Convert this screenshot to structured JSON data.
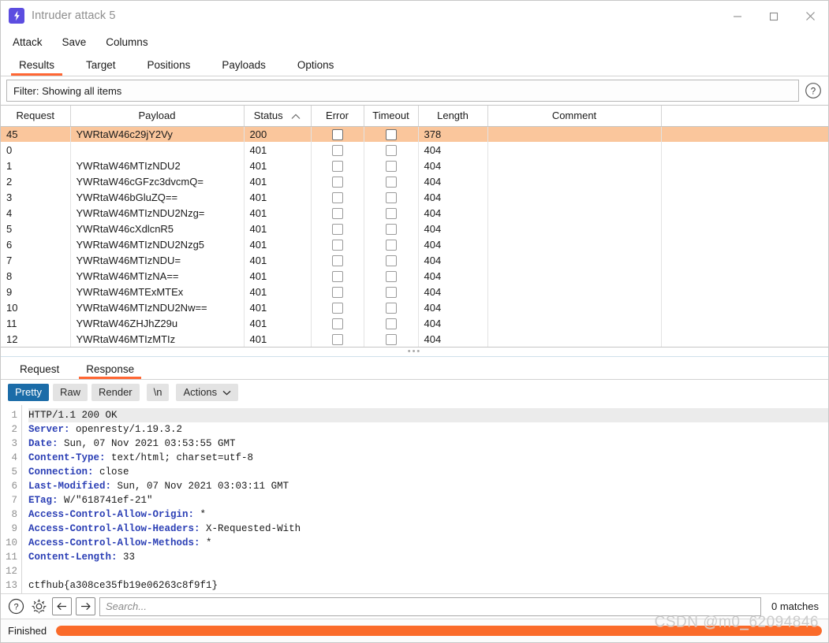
{
  "window": {
    "title": "Intruder attack 5",
    "icon": "lightning-bolt-icon",
    "controls": {
      "minimize": "minimize-icon",
      "maximize": "maximize-icon",
      "close": "close-icon"
    }
  },
  "menubar": {
    "items": [
      "Attack",
      "Save",
      "Columns"
    ]
  },
  "main_tabs": {
    "items": [
      "Results",
      "Target",
      "Positions",
      "Payloads",
      "Options"
    ],
    "active": "Results",
    "accent": "#ff6633"
  },
  "filter": {
    "text": "Filter: Showing all items",
    "help_icon": "help-circle-icon"
  },
  "results_table": {
    "columns": [
      "Request",
      "Payload",
      "Status",
      "Error",
      "Timeout",
      "Length",
      "Comment",
      ""
    ],
    "sort_column": "Status",
    "sort_direction": "ascending",
    "highlight_color": "#fac69c",
    "rows": [
      {
        "request": "45",
        "payload": "YWRtaW46c29jY2Vy",
        "status": "200",
        "error": false,
        "timeout": false,
        "length": "378",
        "comment": "",
        "highlighted": true
      },
      {
        "request": "0",
        "payload": "",
        "status": "401",
        "error": false,
        "timeout": false,
        "length": "404",
        "comment": "",
        "highlighted": false
      },
      {
        "request": "1",
        "payload": "YWRtaW46MTIzNDU2",
        "status": "401",
        "error": false,
        "timeout": false,
        "length": "404",
        "comment": "",
        "highlighted": false
      },
      {
        "request": "2",
        "payload": "YWRtaW46cGFzc3dvcmQ=",
        "status": "401",
        "error": false,
        "timeout": false,
        "length": "404",
        "comment": "",
        "highlighted": false
      },
      {
        "request": "3",
        "payload": "YWRtaW46bGluZQ==",
        "status": "401",
        "error": false,
        "timeout": false,
        "length": "404",
        "comment": "",
        "highlighted": false
      },
      {
        "request": "4",
        "payload": "YWRtaW46MTIzNDU2Nzg=",
        "status": "401",
        "error": false,
        "timeout": false,
        "length": "404",
        "comment": "",
        "highlighted": false
      },
      {
        "request": "5",
        "payload": "YWRtaW46cXdlcnR5",
        "status": "401",
        "error": false,
        "timeout": false,
        "length": "404",
        "comment": "",
        "highlighted": false
      },
      {
        "request": "6",
        "payload": "YWRtaW46MTIzNDU2Nzg5",
        "status": "401",
        "error": false,
        "timeout": false,
        "length": "404",
        "comment": "",
        "highlighted": false
      },
      {
        "request": "7",
        "payload": "YWRtaW46MTIzNDU=",
        "status": "401",
        "error": false,
        "timeout": false,
        "length": "404",
        "comment": "",
        "highlighted": false
      },
      {
        "request": "8",
        "payload": "YWRtaW46MTIzNA==",
        "status": "401",
        "error": false,
        "timeout": false,
        "length": "404",
        "comment": "",
        "highlighted": false
      },
      {
        "request": "9",
        "payload": "YWRtaW46MTExMTEx",
        "status": "401",
        "error": false,
        "timeout": false,
        "length": "404",
        "comment": "",
        "highlighted": false
      },
      {
        "request": "10",
        "payload": "YWRtaW46MTIzNDU2Nw==",
        "status": "401",
        "error": false,
        "timeout": false,
        "length": "404",
        "comment": "",
        "highlighted": false
      },
      {
        "request": "11",
        "payload": "YWRtaW46ZHJhZ29u",
        "status": "401",
        "error": false,
        "timeout": false,
        "length": "404",
        "comment": "",
        "highlighted": false
      },
      {
        "request": "12",
        "payload": "YWRtaW46MTIzMTIz",
        "status": "401",
        "error": false,
        "timeout": false,
        "length": "404",
        "comment": "",
        "highlighted": false
      }
    ]
  },
  "splitter": {
    "handle": "three-dots"
  },
  "message_tabs": {
    "items": [
      "Request",
      "Response"
    ],
    "active": "Response"
  },
  "viewer_toolbar": {
    "buttons": [
      "Pretty",
      "Raw",
      "Render"
    ],
    "selected": "Pretty",
    "newline_button": "\\n",
    "actions_button": "Actions",
    "actions_chevron": "chevron-down-icon"
  },
  "response": {
    "lines": [
      {
        "n": "1",
        "name": "",
        "value": "HTTP/1.1 200 OK"
      },
      {
        "n": "2",
        "name": "Server:",
        "value": " openresty/1.19.3.2"
      },
      {
        "n": "3",
        "name": "Date:",
        "value": " Sun, 07 Nov 2021 03:53:55 GMT"
      },
      {
        "n": "4",
        "name": "Content-Type:",
        "value": " text/html; charset=utf-8"
      },
      {
        "n": "5",
        "name": "Connection:",
        "value": " close"
      },
      {
        "n": "6",
        "name": "Last-Modified:",
        "value": " Sun, 07 Nov 2021 03:03:11 GMT"
      },
      {
        "n": "7",
        "name": "ETag:",
        "value": " W/\"618741ef-21\""
      },
      {
        "n": "8",
        "name": "Access-Control-Allow-Origin:",
        "value": " *"
      },
      {
        "n": "9",
        "name": "Access-Control-Allow-Headers:",
        "value": " X-Requested-With"
      },
      {
        "n": "10",
        "name": "Access-Control-Allow-Methods:",
        "value": " *"
      },
      {
        "n": "11",
        "name": "Content-Length:",
        "value": " 33"
      },
      {
        "n": "12",
        "name": "",
        "value": ""
      },
      {
        "n": "13",
        "name": "",
        "value": "ctfhub{a308ce35fb19e06263c8f9f1}"
      }
    ]
  },
  "search_bar": {
    "help_icon": "help-circle-icon",
    "settings_icon": "gear-icon",
    "back_icon": "arrow-left-icon",
    "forward_icon": "arrow-right-icon",
    "placeholder": "Search...",
    "value": "",
    "matches": "0 matches"
  },
  "status_bar": {
    "label": "Finished",
    "progress_percent": 100,
    "progress_color": "#fa6a29"
  },
  "watermark": {
    "text": "CSDN @m0_62094846"
  }
}
